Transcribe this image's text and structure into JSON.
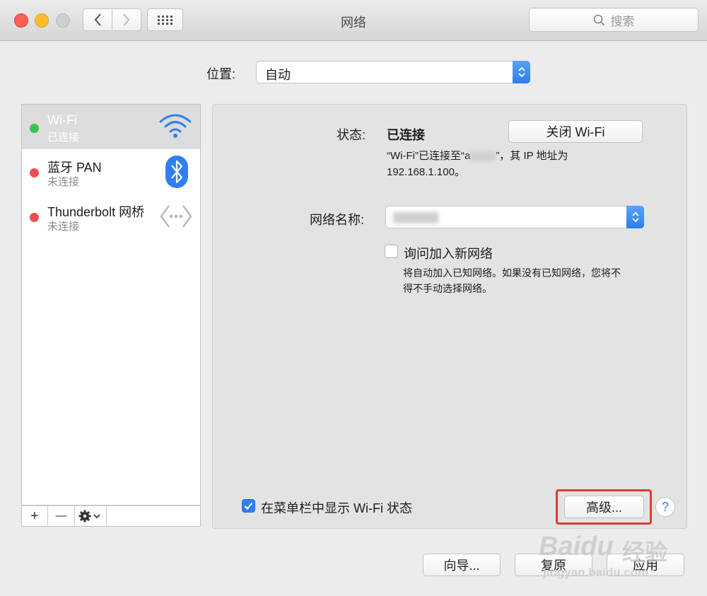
{
  "window": {
    "title": "网络"
  },
  "toolbar": {
    "search_placeholder": "搜索"
  },
  "location": {
    "label": "位置:",
    "value": "自动"
  },
  "services": [
    {
      "name": "Wi-Fi",
      "status": "已连接",
      "dot_color": "#3cc24a",
      "icon": "wifi-icon",
      "selected": true
    },
    {
      "name": "蓝牙 PAN",
      "status": "未连接",
      "dot_color": "#ef4c4c",
      "icon": "bluetooth-icon",
      "selected": false
    },
    {
      "name": "Thunderbolt 网桥",
      "status": "未连接",
      "dot_color": "#ef4c4c",
      "icon": "thunderbolt-bridge-icon",
      "selected": false
    }
  ],
  "sidebar_buttons": {
    "add": "+",
    "remove": "—"
  },
  "detail": {
    "status_label": "状态:",
    "status_value": "已连接",
    "turn_off_button": "关闭 Wi-Fi",
    "status_desc_1": "“Wi-Fi”已连接至“a",
    "status_desc_2": "”，其 IP 地址为",
    "ip_line": "192.168.1.100。",
    "network_name_label": "网络名称:",
    "ask_join_label": "询问加入新网络",
    "ask_join_checked": false,
    "ask_join_desc_1": "将自动加入已知网络。如果没有已知网络，您将不",
    "ask_join_desc_2": "得不手动选择网络。",
    "show_menubar_label": "在菜单栏中显示 Wi-Fi 状态",
    "show_menubar_checked": true,
    "advanced_button": "高级...",
    "help_button": "?"
  },
  "footer": {
    "assist_button": "向导...",
    "revert_button": "复原",
    "apply_button": "应用"
  },
  "watermark": {
    "brand": "Baidu",
    "suffix": "经验",
    "url": "jingyan.baidu.com"
  },
  "colors": {
    "accent": "#2f7ff0",
    "highlight": "#e23a2e",
    "selection": "#dcdcdc"
  }
}
